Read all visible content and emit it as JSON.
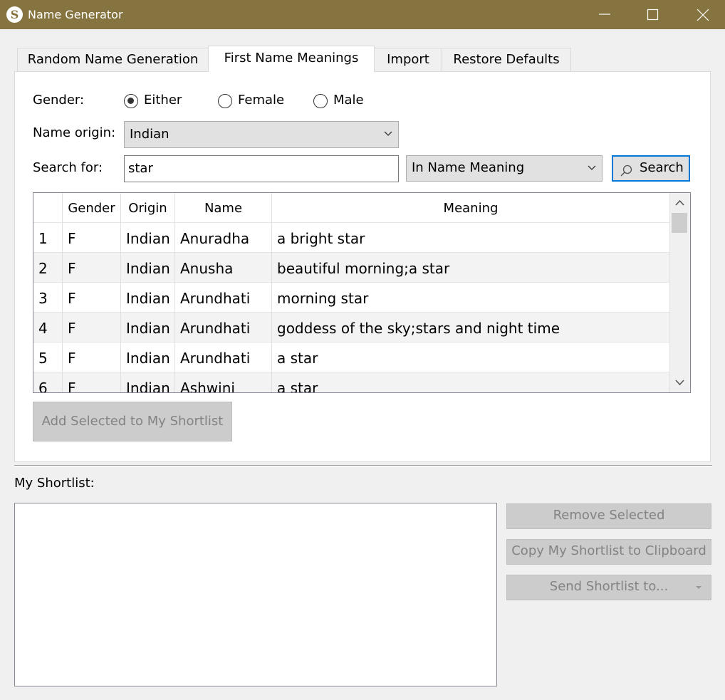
{
  "window": {
    "title": "Name Generator",
    "icon_letter": "S",
    "accent": "#85743f"
  },
  "tabs": [
    {
      "label": "Random Name Generation"
    },
    {
      "label": "First Name Meanings"
    },
    {
      "label": "Import"
    },
    {
      "label": "Restore Defaults"
    }
  ],
  "form": {
    "gender_label": "Gender:",
    "gender_options": [
      "Either",
      "Female",
      "Male"
    ],
    "gender_selected": "Either",
    "origin_label": "Name origin:",
    "origin_value": "Indian",
    "search_label": "Search for:",
    "search_value": "star",
    "search_scope": "In Name Meaning",
    "search_button": "Search"
  },
  "table": {
    "columns": [
      "",
      "Gender",
      "Origin",
      "Name",
      "Meaning"
    ],
    "rows": [
      {
        "num": "1",
        "gender": "F",
        "origin": "Indian",
        "name": "Anuradha",
        "meaning": "a bright star"
      },
      {
        "num": "2",
        "gender": "F",
        "origin": "Indian",
        "name": "Anusha",
        "meaning": "beautiful morning;a star"
      },
      {
        "num": "3",
        "gender": "F",
        "origin": "Indian",
        "name": "Arundhati",
        "meaning": "morning star"
      },
      {
        "num": "4",
        "gender": "F",
        "origin": "Indian",
        "name": "Arundhati",
        "meaning": "goddess of the sky;stars and night time"
      },
      {
        "num": "5",
        "gender": "F",
        "origin": "Indian",
        "name": "Arundhati",
        "meaning": "a star"
      },
      {
        "num": "6",
        "gender": "F",
        "origin": "Indian",
        "name": "Ashwini",
        "meaning": "a star"
      }
    ]
  },
  "add_button": "Add Selected to My Shortlist",
  "shortlist": {
    "label": "My Shortlist:",
    "remove_button": "Remove Selected",
    "copy_button": "Copy My Shortlist to Clipboard",
    "send_button": "Send Shortlist to..."
  }
}
